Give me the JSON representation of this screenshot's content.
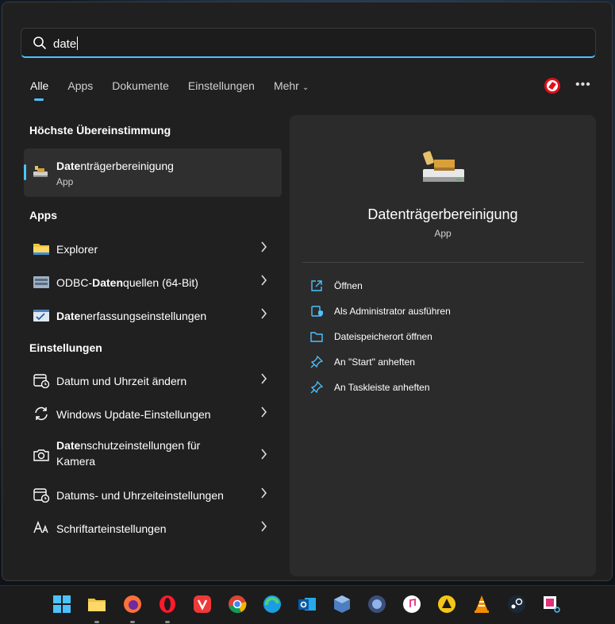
{
  "search": {
    "query": "date"
  },
  "tabs": [
    {
      "label": "Alle"
    },
    {
      "label": "Apps"
    },
    {
      "label": "Dokumente"
    },
    {
      "label": "Einstellungen"
    },
    {
      "label": "Mehr"
    }
  ],
  "sections": {
    "best": "Höchste Übereinstimmung",
    "apps": "Apps",
    "settings": "Einstellungen"
  },
  "best_match": {
    "title_highlight": "Date",
    "title_rest": "nträgerbereinigung",
    "subtitle": "App"
  },
  "apps": [
    {
      "pre": "",
      "highlight": "",
      "rest": "Explorer"
    },
    {
      "pre": "ODBC-",
      "highlight": "Daten",
      "rest": "quellen (64-Bit)"
    },
    {
      "pre": "",
      "highlight": "Date",
      "rest": "nerfassungseinstellungen"
    }
  ],
  "settings": [
    {
      "pre": "",
      "highlight": "",
      "rest": "Datum und Uhrzeit ändern"
    },
    {
      "pre": "",
      "highlight": "",
      "rest": "Windows Update-Einstellungen"
    },
    {
      "pre": "",
      "highlight": "Date",
      "rest": "nschutzeinstellungen für",
      "line2": "Kamera"
    },
    {
      "pre": "",
      "highlight": "",
      "rest": "Datums- und Uhrzeiteinstellungen"
    },
    {
      "pre": "",
      "highlight": "",
      "rest": "Schriftarteinstellungen"
    }
  ],
  "detail": {
    "title": "Datenträgerbereinigung",
    "subtitle": "App",
    "actions": [
      {
        "label": "Öffnen",
        "icon": "open-icon"
      },
      {
        "label": "Als Administrator ausführen",
        "icon": "admin-shield-icon"
      },
      {
        "label": "Dateispeicherort öffnen",
        "icon": "folder-icon"
      },
      {
        "label": "An \"Start\" anheften",
        "icon": "pin-icon"
      },
      {
        "label": "An Taskleiste anheften",
        "icon": "pin-icon"
      }
    ]
  },
  "colors": {
    "accent": "#4cc2ff",
    "panel": "#202020",
    "detail": "#2b2b2b"
  }
}
